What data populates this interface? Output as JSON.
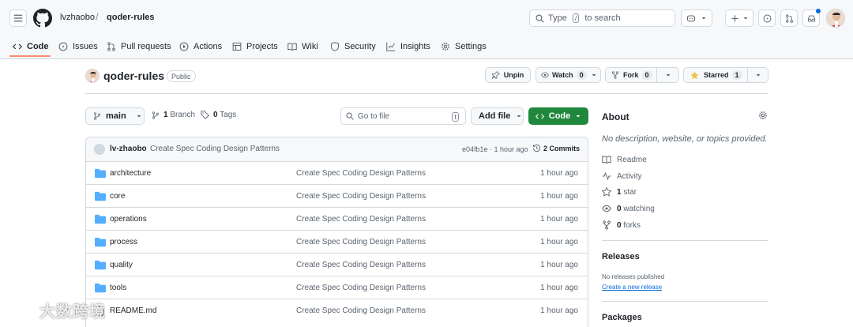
{
  "breadcrumb": {
    "owner": "lvzhaobo",
    "separator": "/",
    "repo": "qoder-rules"
  },
  "search": {
    "prefix": "Type",
    "key": "/",
    "suffix": "to search"
  },
  "tabs": [
    {
      "label": "Code",
      "icon": "code-icon",
      "active": true
    },
    {
      "label": "Issues",
      "icon": "issue-icon"
    },
    {
      "label": "Pull requests",
      "icon": "pull-request-icon"
    },
    {
      "label": "Actions",
      "icon": "play-icon"
    },
    {
      "label": "Projects",
      "icon": "table-icon"
    },
    {
      "label": "Wiki",
      "icon": "book-icon"
    },
    {
      "label": "Security",
      "icon": "shield-icon"
    },
    {
      "label": "Insights",
      "icon": "graph-icon"
    },
    {
      "label": "Settings",
      "icon": "gear-icon"
    }
  ],
  "repo": {
    "name": "qoder-rules",
    "visibility": "Public",
    "unpin_label": "Unpin",
    "watch_label": "Watch",
    "watch_count": "0",
    "fork_label": "Fork",
    "fork_count": "0",
    "star_label": "Starred",
    "star_count": "1"
  },
  "controls": {
    "branch": "main",
    "branches_count": "1",
    "branches_label": "Branch",
    "tags_count": "0",
    "tags_label": "Tags",
    "goto_placeholder": "Go to file",
    "goto_key": "t",
    "add_file": "Add file",
    "code": "Code"
  },
  "latest_commit": {
    "user": "lv-zhaobo",
    "message": "Create Spec Coding Design Patterns",
    "meta": "e04fb1e · 1 hour ago",
    "count_label": "2 Commits"
  },
  "files": [
    {
      "name": "architecture",
      "type": "folder",
      "message": "Create Spec Coding Design Patterns",
      "time": "1 hour ago"
    },
    {
      "name": "core",
      "type": "folder",
      "message": "Create Spec Coding Design Patterns",
      "time": "1 hour ago"
    },
    {
      "name": "operations",
      "type": "folder",
      "message": "Create Spec Coding Design Patterns",
      "time": "1 hour ago"
    },
    {
      "name": "process",
      "type": "folder",
      "message": "Create Spec Coding Design Patterns",
      "time": "1 hour ago"
    },
    {
      "name": "quality",
      "type": "folder",
      "message": "Create Spec Coding Design Patterns",
      "time": "1 hour ago"
    },
    {
      "name": "tools",
      "type": "folder",
      "message": "Create Spec Coding Design Patterns",
      "time": "1 hour ago"
    },
    {
      "name": "README.md",
      "type": "file",
      "message": "Create Spec Coding Design Patterns",
      "time": "1 hour ago"
    }
  ],
  "about": {
    "heading": "About",
    "description": "No description, website, or topics provided.",
    "readme": "Readme",
    "activity": "Activity",
    "stars_count": "1",
    "stars_label": "star",
    "watching_count": "0",
    "watching_label": "watching",
    "forks_count": "0",
    "forks_label": "forks"
  },
  "releases": {
    "heading": "Releases",
    "none": "No releases published",
    "create_link": "Create a new release"
  },
  "packages": {
    "heading": "Packages"
  },
  "watermark": "大数跨境",
  "colors": {
    "accent_green": "#1f883d",
    "folder_blue": "#54aeff",
    "link_blue": "#0969da",
    "tab_underline": "#fd8c73"
  }
}
